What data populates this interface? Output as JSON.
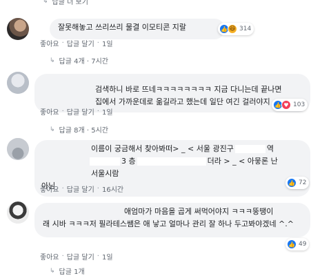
{
  "top_reply": {
    "label": "답글 더 보기"
  },
  "comments": [
    {
      "text": "잘못해놓고 쓰리쓰리 물결 이모티콘 지랄",
      "reactions": {
        "count": "314",
        "icons": [
          "like-icon",
          "haha-icon"
        ]
      },
      "actions": {
        "like": "좋아요",
        "reply": "답글 달기",
        "time": "1일"
      },
      "replies": "답글 4개 · 7시간"
    },
    {
      "text": "검색하니 바로 뜨네ㅋㅋㅋㅋㅋㅋㅋㅋ 지금 다니는데 끝나면 집에서 가까운데로 옮길라고 했는데 일단 여긴 걸러야지",
      "reactions": {
        "count": "103",
        "icons": [
          "like-icon",
          "love-icon"
        ]
      },
      "actions": {
        "like": "좋아요",
        "reply": "답글 달기",
        "time": "1일"
      },
      "replies": "답글 8개 · 5시간"
    },
    {
      "text_parts": [
        "이름이 궁금해서 찾아봐떠> _ < 서울 광진구",
        "역",
        "3 층",
        "더라 > _ < 아뭏론 난 서울시람",
        "아님"
      ],
      "reactions": {
        "count": "72",
        "icons": [
          "like-icon"
        ]
      },
      "actions": {
        "like": "좋아요",
        "reply": "답글 달기",
        "time": "16시간"
      }
    },
    {
      "text_parts": [
        "애엄마가 마음을 곱게 써먹어야지 ㅋㅋㅋ뚱땡이",
        "래 시바 ㅋㅋㅋ저 필라테스쌤은 애 낳고 얼마나 관리 잘 하나 두고봐야겠네 ^.^"
      ],
      "reactions": {
        "count": "49",
        "icons": [
          "like-icon"
        ]
      },
      "actions": {
        "like": "좋아요",
        "reply": "답글 달기",
        "time": "1일"
      },
      "replies": "답글 1개"
    }
  ]
}
